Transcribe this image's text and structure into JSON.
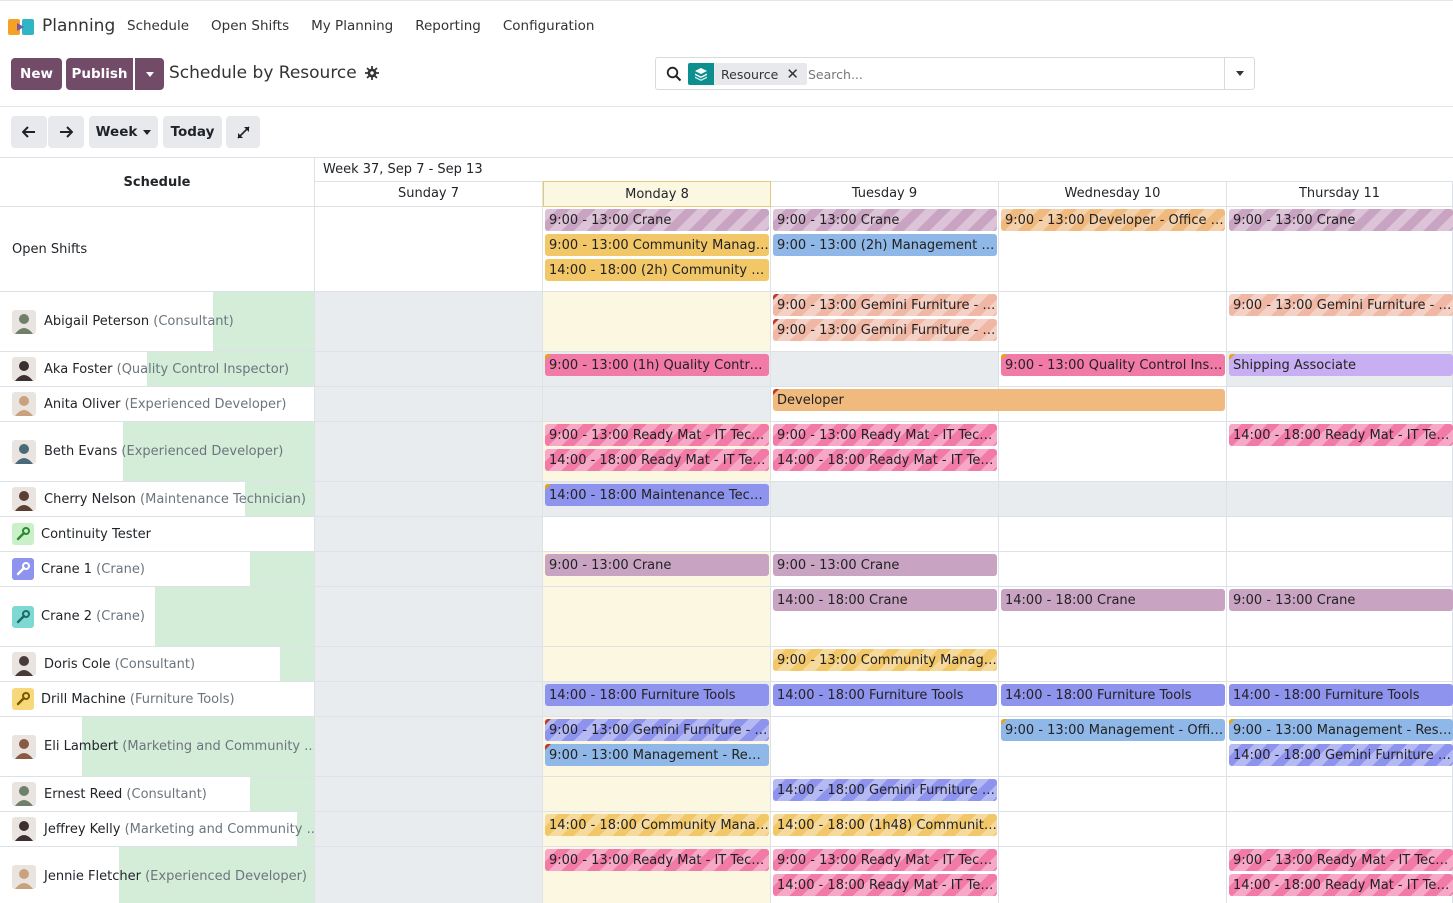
{
  "app": {
    "name": "Planning"
  },
  "menu": [
    "Schedule",
    "Open Shifts",
    "My Planning",
    "Reporting",
    "Configuration"
  ],
  "toolbar": {
    "new_label": "New",
    "publish_label": "Publish",
    "title": "Schedule by Resource"
  },
  "search": {
    "facet_label": "Resource",
    "placeholder": "Search..."
  },
  "nav": {
    "scale_label": "Week",
    "today_label": "Today"
  },
  "gantt": {
    "header_left": "Schedule",
    "week_label": "Week 37, Sep 7 - Sep 13",
    "days": [
      "Sunday 7",
      "Monday 8",
      "Tuesday 9",
      "Wednesday 10",
      "Thursday 11"
    ],
    "rows": [
      {
        "name": "Open Shifts",
        "role": "",
        "avatar": "none"
      },
      {
        "name": "Abigail Peterson",
        "role": "(Consultant)",
        "avatar": "person"
      },
      {
        "name": "Aka Foster",
        "role": "(Quality Control Inspector)",
        "avatar": "person"
      },
      {
        "name": "Anita Oliver",
        "role": "(Experienced Developer)",
        "avatar": "person"
      },
      {
        "name": "Beth Evans",
        "role": "(Experienced Developer)",
        "avatar": "person"
      },
      {
        "name": "Cherry Nelson",
        "role": "(Maintenance Technician)",
        "avatar": "person"
      },
      {
        "name": "Continuity Tester",
        "role": "",
        "avatar": "wrench-icon"
      },
      {
        "name": "Crane 1",
        "role": "(Crane)",
        "avatar": "wrench-icon"
      },
      {
        "name": "Crane 2",
        "role": "(Crane)",
        "avatar": "wrench-icon"
      },
      {
        "name": "Doris Cole",
        "role": "(Consultant)",
        "avatar": "person"
      },
      {
        "name": "Drill Machine",
        "role": "(Furniture Tools)",
        "avatar": "wrench-icon"
      },
      {
        "name": "Eli Lambert",
        "role": "(Marketing and Community ...",
        "avatar": "person"
      },
      {
        "name": "Ernest Reed",
        "role": "(Consultant)",
        "avatar": "person"
      },
      {
        "name": "Jeffrey Kelly",
        "role": "(Marketing and Community ...",
        "avatar": "person"
      },
      {
        "name": "Jennie Fletcher",
        "role": "(Experienced Developer)",
        "avatar": "person"
      }
    ],
    "shifts": [
      {
        "row": 0,
        "day": 1,
        "lane": 0,
        "span": 1,
        "label": "9:00 - 13:00 Crane",
        "color": "#c9a3c2",
        "striped": true
      },
      {
        "row": 0,
        "day": 1,
        "lane": 1,
        "span": 1,
        "label": "9:00 - 13:00 Community Manager",
        "color": "#f2c768"
      },
      {
        "row": 0,
        "day": 1,
        "lane": 2,
        "span": 1,
        "label": "14:00 - 18:00 (2h) Community Ma...",
        "color": "#f2c768"
      },
      {
        "row": 0,
        "day": 2,
        "lane": 0,
        "span": 1,
        "label": "9:00 - 13:00 Crane",
        "color": "#c9a3c2",
        "striped": true
      },
      {
        "row": 0,
        "day": 2,
        "lane": 1,
        "span": 1,
        "label": "9:00 - 13:00 (2h) Management - R...",
        "color": "#8fb8e8"
      },
      {
        "row": 0,
        "day": 3,
        "lane": 0,
        "span": 1,
        "label": "9:00 - 13:00 Developer - Office D...",
        "color": "#f0b97e",
        "striped": true
      },
      {
        "row": 0,
        "day": 4,
        "lane": 0,
        "span": 1,
        "label": "9:00 - 13:00 Crane",
        "color": "#c9a3c2",
        "striped": true
      },
      {
        "row": 1,
        "day": 2,
        "lane": 0,
        "span": 1,
        "label": "9:00 - 13:00 Gemini Furniture - Fu...",
        "color": "#f0b7a4",
        "striped": true,
        "corner": "red"
      },
      {
        "row": 1,
        "day": 2,
        "lane": 1,
        "span": 1,
        "label": "9:00 - 13:00 Gemini Furniture - Fu...",
        "color": "#f0b7a4",
        "striped": true,
        "corner": "red"
      },
      {
        "row": 1,
        "day": 4,
        "lane": 0,
        "span": 1,
        "label": "9:00 - 13:00 Gemini Furniture - Fu...",
        "color": "#f0b7a4",
        "striped": true
      },
      {
        "row": 2,
        "day": 1,
        "lane": 0,
        "span": 1,
        "label": "9:00 - 13:00 (1h) Quality Control I...",
        "color": "#f27aa7",
        "corner": "yellow"
      },
      {
        "row": 2,
        "day": 3,
        "lane": 0,
        "span": 1,
        "label": "9:00 - 13:00 Quality Control Inspe...",
        "color": "#f27aa7",
        "corner": "yellow"
      },
      {
        "row": 2,
        "day": 4,
        "lane": 0,
        "span": 1,
        "label": "Shipping Associate",
        "color": "#c8aef2",
        "corner": "yellow"
      },
      {
        "row": 3,
        "day": 2,
        "lane": 0,
        "span": 2,
        "label": "Developer",
        "color": "#f0b97e",
        "corner": "red"
      },
      {
        "row": 4,
        "day": 1,
        "lane": 0,
        "span": 1,
        "label": "9:00 - 13:00 Ready Mat - IT Techn...",
        "color": "#f27aa7",
        "striped": true
      },
      {
        "row": 4,
        "day": 1,
        "lane": 1,
        "span": 1,
        "label": "14:00 - 18:00 Ready Mat - IT Tech...",
        "color": "#f27aa7",
        "striped": true
      },
      {
        "row": 4,
        "day": 2,
        "lane": 0,
        "span": 1,
        "label": "9:00 - 13:00 Ready Mat - IT Techn...",
        "color": "#f27aa7",
        "striped": true
      },
      {
        "row": 4,
        "day": 2,
        "lane": 1,
        "span": 1,
        "label": "14:00 - 18:00 Ready Mat - IT Tech...",
        "color": "#f27aa7",
        "striped": true
      },
      {
        "row": 4,
        "day": 4,
        "lane": 0,
        "span": 1,
        "label": "14:00 - 18:00 Ready Mat - IT Tech...",
        "color": "#f27aa7",
        "striped": true
      },
      {
        "row": 5,
        "day": 1,
        "lane": 0,
        "span": 1,
        "label": "14:00 - 18:00 Maintenance Techni...",
        "color": "#8e93ee",
        "corner": "yellow"
      },
      {
        "row": 7,
        "day": 1,
        "lane": 0,
        "span": 1,
        "label": "9:00 - 13:00 Crane",
        "color": "#c9a3c2"
      },
      {
        "row": 7,
        "day": 2,
        "lane": 0,
        "span": 1,
        "label": "9:00 - 13:00 Crane",
        "color": "#c9a3c2"
      },
      {
        "row": 8,
        "day": 2,
        "lane": 0,
        "span": 1,
        "label": "14:00 - 18:00 Crane",
        "color": "#c9a3c2"
      },
      {
        "row": 8,
        "day": 3,
        "lane": 0,
        "span": 1,
        "label": "14:00 - 18:00 Crane",
        "color": "#c9a3c2"
      },
      {
        "row": 8,
        "day": 4,
        "lane": 0,
        "span": 1,
        "label": "9:00 - 13:00 Crane",
        "color": "#c9a3c2"
      },
      {
        "row": 9,
        "day": 2,
        "lane": 0,
        "span": 1,
        "label": "9:00 - 13:00 Community Manager...",
        "color": "#f2c768",
        "striped": true
      },
      {
        "row": 10,
        "day": 1,
        "lane": 0,
        "span": 1,
        "label": "14:00 - 18:00 Furniture Tools",
        "color": "#8e93ee"
      },
      {
        "row": 10,
        "day": 2,
        "lane": 0,
        "span": 1,
        "label": "14:00 - 18:00 Furniture Tools",
        "color": "#8e93ee"
      },
      {
        "row": 10,
        "day": 3,
        "lane": 0,
        "span": 1,
        "label": "14:00 - 18:00 Furniture Tools",
        "color": "#8e93ee"
      },
      {
        "row": 10,
        "day": 4,
        "lane": 0,
        "span": 1,
        "label": "14:00 - 18:00 Furniture Tools",
        "color": "#8e93ee"
      },
      {
        "row": 11,
        "day": 1,
        "lane": 0,
        "span": 1,
        "label": "9:00 - 13:00 Gemini Furniture - W...",
        "color": "#8e93ee",
        "striped": true,
        "corner": "red"
      },
      {
        "row": 11,
        "day": 1,
        "lane": 1,
        "span": 1,
        "label": "9:00 - 13:00 Management - Reno...",
        "color": "#8fb8e8",
        "corner": "red"
      },
      {
        "row": 11,
        "day": 3,
        "lane": 0,
        "span": 1,
        "label": "9:00 - 13:00 Management - Offic...",
        "color": "#8fb8e8",
        "corner": "yellow"
      },
      {
        "row": 11,
        "day": 4,
        "lane": 0,
        "span": 1,
        "label": "9:00 - 13:00 Management - Resea...",
        "color": "#8fb8e8",
        "corner": "yellow"
      },
      {
        "row": 11,
        "day": 4,
        "lane": 1,
        "span": 1,
        "label": "14:00 - 18:00 Gemini Furniture - ...",
        "color": "#8e93ee",
        "striped": true
      },
      {
        "row": 12,
        "day": 2,
        "lane": 0,
        "span": 1,
        "label": "14:00 - 18:00 Gemini Furniture - ...",
        "color": "#8e93ee",
        "striped": true
      },
      {
        "row": 13,
        "day": 1,
        "lane": 0,
        "span": 1,
        "label": "14:00 - 18:00 Community Manag...",
        "color": "#f2c768",
        "striped": true
      },
      {
        "row": 13,
        "day": 2,
        "lane": 0,
        "span": 1,
        "label": "14:00 - 18:00 (1h48) Community ...",
        "color": "#f2c768",
        "striped": true
      },
      {
        "row": 14,
        "day": 1,
        "lane": 0,
        "span": 1,
        "label": "9:00 - 13:00 Ready Mat - IT Techn...",
        "color": "#f27aa7",
        "striped": true
      },
      {
        "row": 14,
        "day": 2,
        "lane": 0,
        "span": 1,
        "label": "9:00 - 13:00 Ready Mat - IT Techn...",
        "color": "#f27aa7",
        "striped": true
      },
      {
        "row": 14,
        "day": 2,
        "lane": 1,
        "span": 1,
        "label": "14:00 - 18:00 Ready Mat - IT Tech...",
        "color": "#f27aa7",
        "striped": true
      },
      {
        "row": 14,
        "day": 4,
        "lane": 0,
        "span": 1,
        "label": "9:00 - 13:00 Ready Mat - IT Techn...",
        "color": "#f27aa7",
        "striped": true
      },
      {
        "row": 14,
        "day": 4,
        "lane": 1,
        "span": 1,
        "label": "14:00 - 18:00 Ready Mat - IT Tech...",
        "color": "#f27aa7",
        "striped": true
      }
    ]
  },
  "colors": {
    "primary": "#714b67",
    "facet_icon": "#0e8f8f",
    "today_bg": "#fcf7e1",
    "off_bg": "#e9ecef",
    "avail_green": "#d4edd9"
  }
}
